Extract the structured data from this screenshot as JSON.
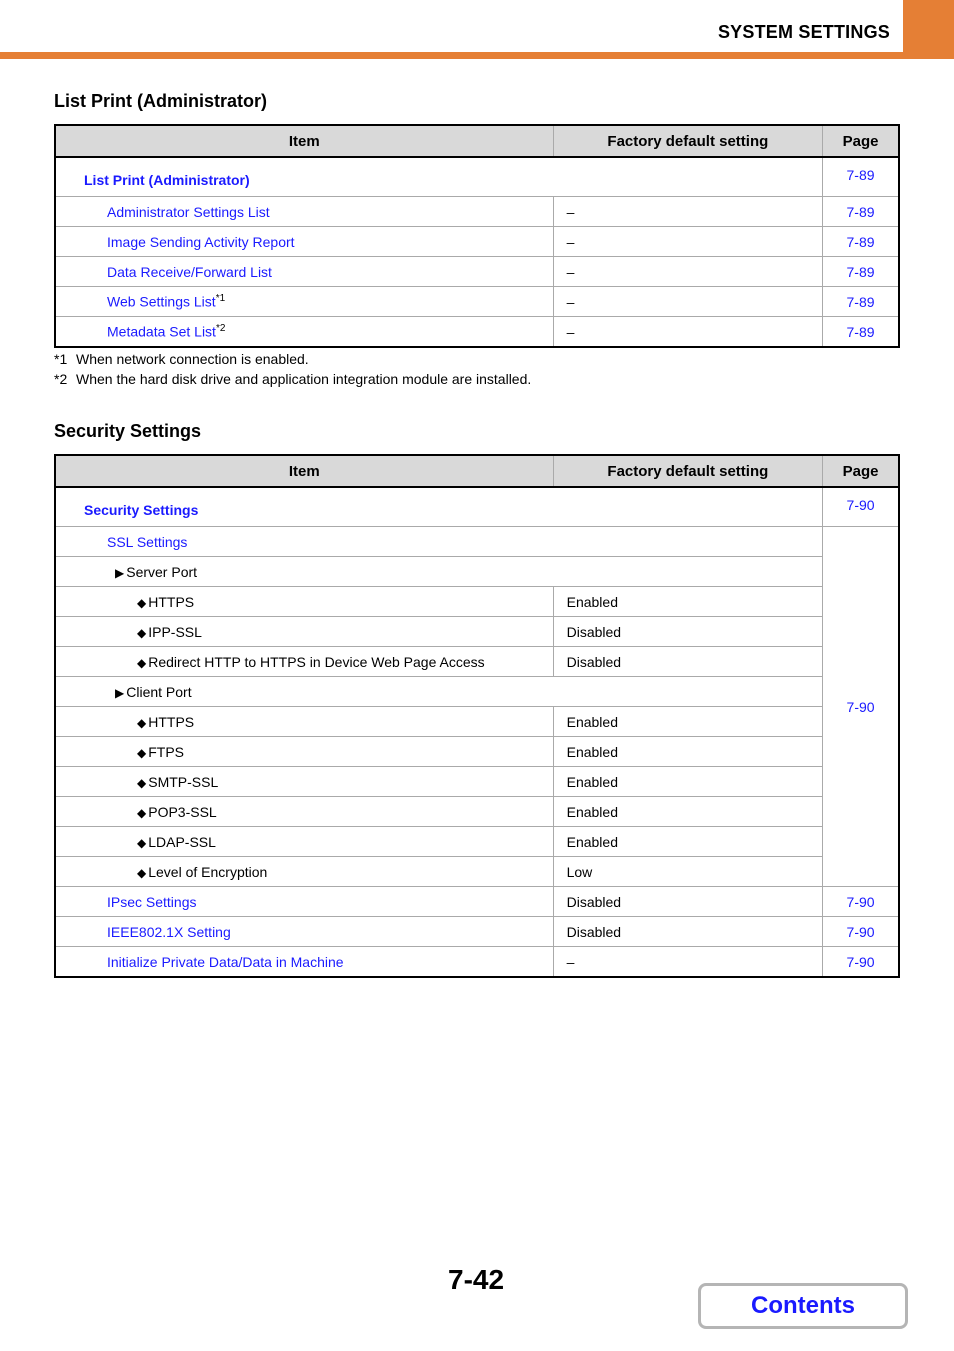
{
  "header": {
    "title": "SYSTEM SETTINGS",
    "accent_color": "#e57f35"
  },
  "columns": {
    "item": "Item",
    "factory": "Factory default setting",
    "page": "Page"
  },
  "list_print": {
    "title": "List Print (Administrator)",
    "group": {
      "label": "List Print (Administrator)",
      "page": "7-89"
    },
    "rows": [
      {
        "label": "Administrator Settings List",
        "sup": "",
        "value": "–",
        "page": "7-89"
      },
      {
        "label": "Image Sending Activity Report",
        "sup": "",
        "value": "–",
        "page": "7-89"
      },
      {
        "label": "Data Receive/Forward List",
        "sup": "",
        "value": "–",
        "page": "7-89"
      },
      {
        "label": "Web Settings List",
        "sup": "*1",
        "value": "–",
        "page": "7-89"
      },
      {
        "label": "Metadata Set List",
        "sup": "*2",
        "value": "–",
        "page": "7-89"
      }
    ],
    "footnotes": [
      {
        "mark": "*1",
        "text": "When network connection is enabled."
      },
      {
        "mark": "*2",
        "text": "When the hard disk drive and application integration module are installed."
      }
    ]
  },
  "security": {
    "title": "Security Settings",
    "group": {
      "label": "Security Settings",
      "page": "7-90"
    },
    "ssl": {
      "label": "SSL Settings",
      "page": "7-90",
      "server_port": {
        "label": "Server Port",
        "rows": [
          {
            "label": "HTTPS",
            "value": "Enabled"
          },
          {
            "label": "IPP-SSL",
            "value": "Disabled"
          },
          {
            "label": "Redirect HTTP to HTTPS in Device Web Page Access",
            "value": "Disabled"
          }
        ]
      },
      "client_port": {
        "label": "Client Port",
        "rows": [
          {
            "label": "HTTPS",
            "value": "Enabled"
          },
          {
            "label": "FTPS",
            "value": "Enabled"
          },
          {
            "label": "SMTP-SSL",
            "value": "Enabled"
          },
          {
            "label": "POP3-SSL",
            "value": "Enabled"
          },
          {
            "label": "LDAP-SSL",
            "value": "Enabled"
          },
          {
            "label": "Level of Encryption",
            "value": "Low"
          }
        ]
      }
    },
    "rows": [
      {
        "label": "IPsec Settings",
        "value": "Disabled",
        "page": "7-90"
      },
      {
        "label": "IEEE802.1X Setting",
        "value": "Disabled",
        "page": "7-90"
      },
      {
        "label": "Initialize Private Data/Data in Machine",
        "value": "–",
        "page": "7-90"
      }
    ]
  },
  "footer": {
    "page_number": "7-42",
    "contents_label": "Contents"
  },
  "icons": {
    "sub_arrow": "▶",
    "bullet": "◆"
  }
}
